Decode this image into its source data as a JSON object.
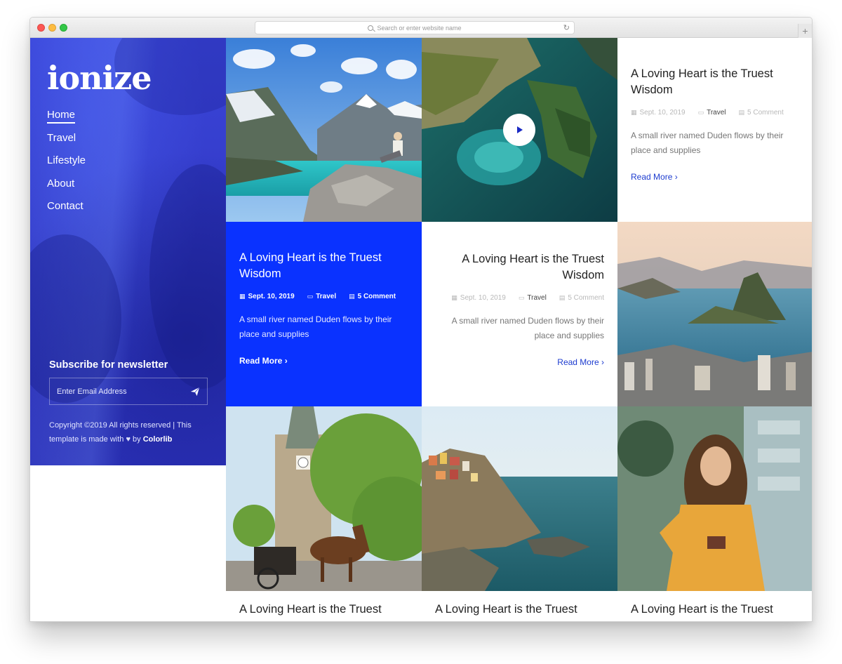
{
  "browser": {
    "url_placeholder": "Search or enter website name",
    "reload_icon": "reload-icon",
    "new_tab_icon": "plus-icon"
  },
  "brand": {
    "logo": "ionize",
    "accent": "#0a32ff"
  },
  "nav": {
    "items": [
      {
        "label": "Home",
        "active": true
      },
      {
        "label": "Travel"
      },
      {
        "label": "Lifestyle"
      },
      {
        "label": "About"
      },
      {
        "label": "Contact"
      }
    ]
  },
  "newsletter": {
    "title": "Subscribe for newsletter",
    "placeholder": "Enter Email Address",
    "submit_icon": "paper-plane-icon"
  },
  "footer": {
    "copyright": "Copyright ©2019 All rights reserved | This template is made with",
    "by": "by",
    "author": "Colorlib"
  },
  "posts": {
    "featured_top": {
      "title": "A Loving Heart is the Truest Wisdom",
      "date": "Sept. 10, 2019",
      "category": "Travel",
      "comments": "5 Comment",
      "excerpt": "A small river named Duden flows by their place and supplies",
      "read_more": "Read More"
    },
    "featured_blue": {
      "title": "A Loving Heart is the Truest Wisdom",
      "date": "Sept. 10, 2019",
      "category": "Travel",
      "comments": "5 Comment",
      "excerpt": "A small river named Duden flows by their place and supplies",
      "read_more": "Read More"
    },
    "featured_right": {
      "title": "A Loving Heart is the Truest Wisdom",
      "date": "Sept. 10, 2019",
      "category": "Travel",
      "comments": "5 Comment",
      "excerpt": "A small river named Duden flows by their place and supplies",
      "read_more": "Read More"
    },
    "bottom_titles": [
      "A Loving Heart is the Truest",
      "A Loving Heart is the Truest",
      "A Loving Heart is the Truest"
    ]
  }
}
